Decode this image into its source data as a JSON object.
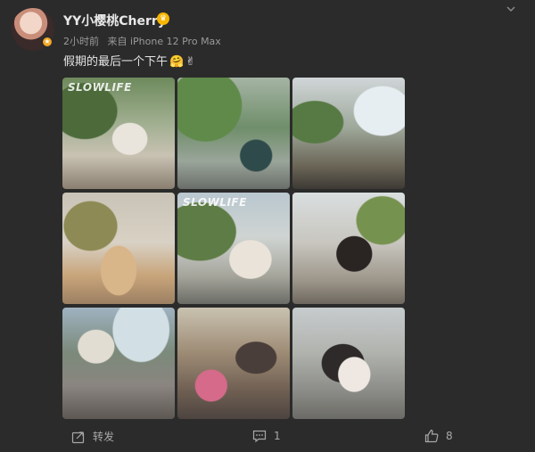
{
  "post": {
    "username": "YY小樱桃Cherry",
    "time": "2小时前",
    "source": "来自 iPhone 12 Pro Max",
    "text": "假期的最后一个下午",
    "text_emoji_1": "🤗",
    "text_emoji_2": "✌",
    "photos": [
      {
        "overlay": "SLOWLIFE"
      },
      {
        "overlay": ""
      },
      {
        "overlay": ""
      },
      {
        "overlay": ""
      },
      {
        "overlay": "SLOWLIFE"
      },
      {
        "overlay": ""
      },
      {
        "overlay": ""
      },
      {
        "overlay": ""
      },
      {
        "overlay": ""
      }
    ]
  },
  "actions": {
    "share_label": "转发",
    "comment_count": "1",
    "like_count": "8"
  },
  "icons": {
    "vip_badge": "crown-icon",
    "avatar_badge": "verified-icon",
    "menu": "chevron-down-icon",
    "share": "share-icon",
    "comment": "comment-icon",
    "like": "thumbs-up-icon"
  },
  "colors": {
    "background": "#2b2b2b",
    "badge": "#f7b500",
    "text": "#e4e4e4",
    "muted": "#9a9a9a"
  }
}
